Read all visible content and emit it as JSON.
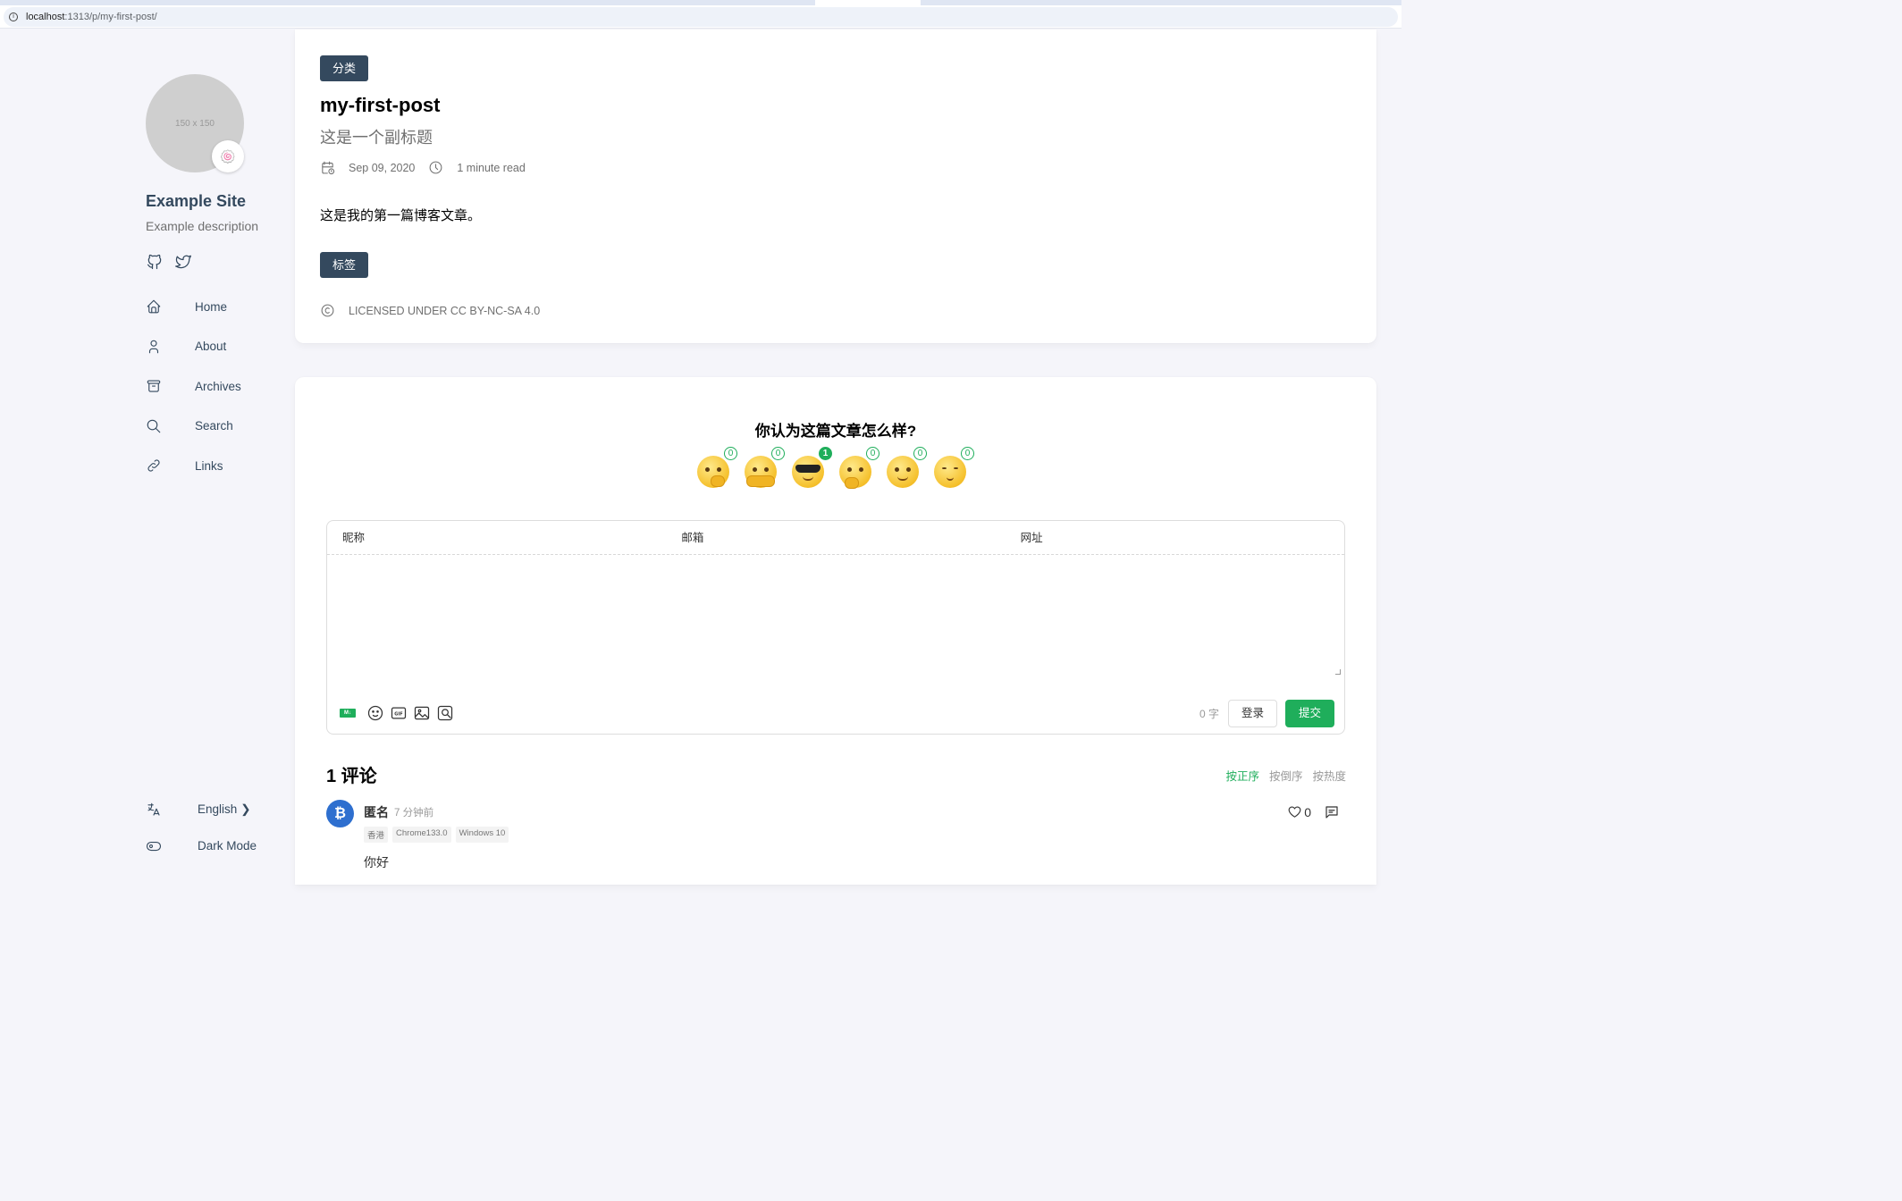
{
  "browser": {
    "url_host": "localhost",
    "url_rest": ":1313/p/my-first-post/"
  },
  "sidebar": {
    "avatar_placeholder": "150 x 150",
    "avatar_emoji": "🍥",
    "site_name": "Example Site",
    "site_description": "Example description",
    "social": [
      "github-icon",
      "twitter-icon"
    ],
    "menu": [
      {
        "label": "Home",
        "icon": "home-icon"
      },
      {
        "label": "About",
        "icon": "user-icon"
      },
      {
        "label": "Archives",
        "icon": "archive-icon"
      },
      {
        "label": "Search",
        "icon": "search-icon"
      },
      {
        "label": "Links",
        "icon": "link-icon"
      }
    ],
    "language": "English",
    "dark_mode": "Dark Mode"
  },
  "post": {
    "category": "分类",
    "title": "my-first-post",
    "subtitle": "这是一个副标题",
    "date": "Sep 09, 2020",
    "read_time": "1 minute read",
    "body": "这是我的第一篇博客文章。",
    "tag": "标签",
    "license": "LICENSED UNDER CC BY-NC-SA 4.0"
  },
  "comments": {
    "reaction_title": "你认为这篇文章怎么样?",
    "reactions": [
      {
        "name": "angry",
        "count": "0"
      },
      {
        "name": "hug",
        "count": "0"
      },
      {
        "name": "cool",
        "count": "1"
      },
      {
        "name": "thinking",
        "count": "0"
      },
      {
        "name": "salute",
        "count": "0"
      },
      {
        "name": "sleepy",
        "count": "0"
      }
    ],
    "fields": {
      "nick": "昵称",
      "mail": "邮箱",
      "link": "网址"
    },
    "word_count": "0 字",
    "login": "登录",
    "submit": "提交",
    "count_title": "1 评论",
    "sort": [
      "按正序",
      "按倒序",
      "按热度"
    ],
    "list": [
      {
        "nick": "匿名",
        "time": "7 分钟前",
        "tags": [
          "香港",
          "Chrome133.0",
          "Windows 10"
        ],
        "body": "你好",
        "likes": "0"
      }
    ]
  },
  "colors": {
    "accent": "#1fae5b",
    "badge": "#34495e"
  }
}
